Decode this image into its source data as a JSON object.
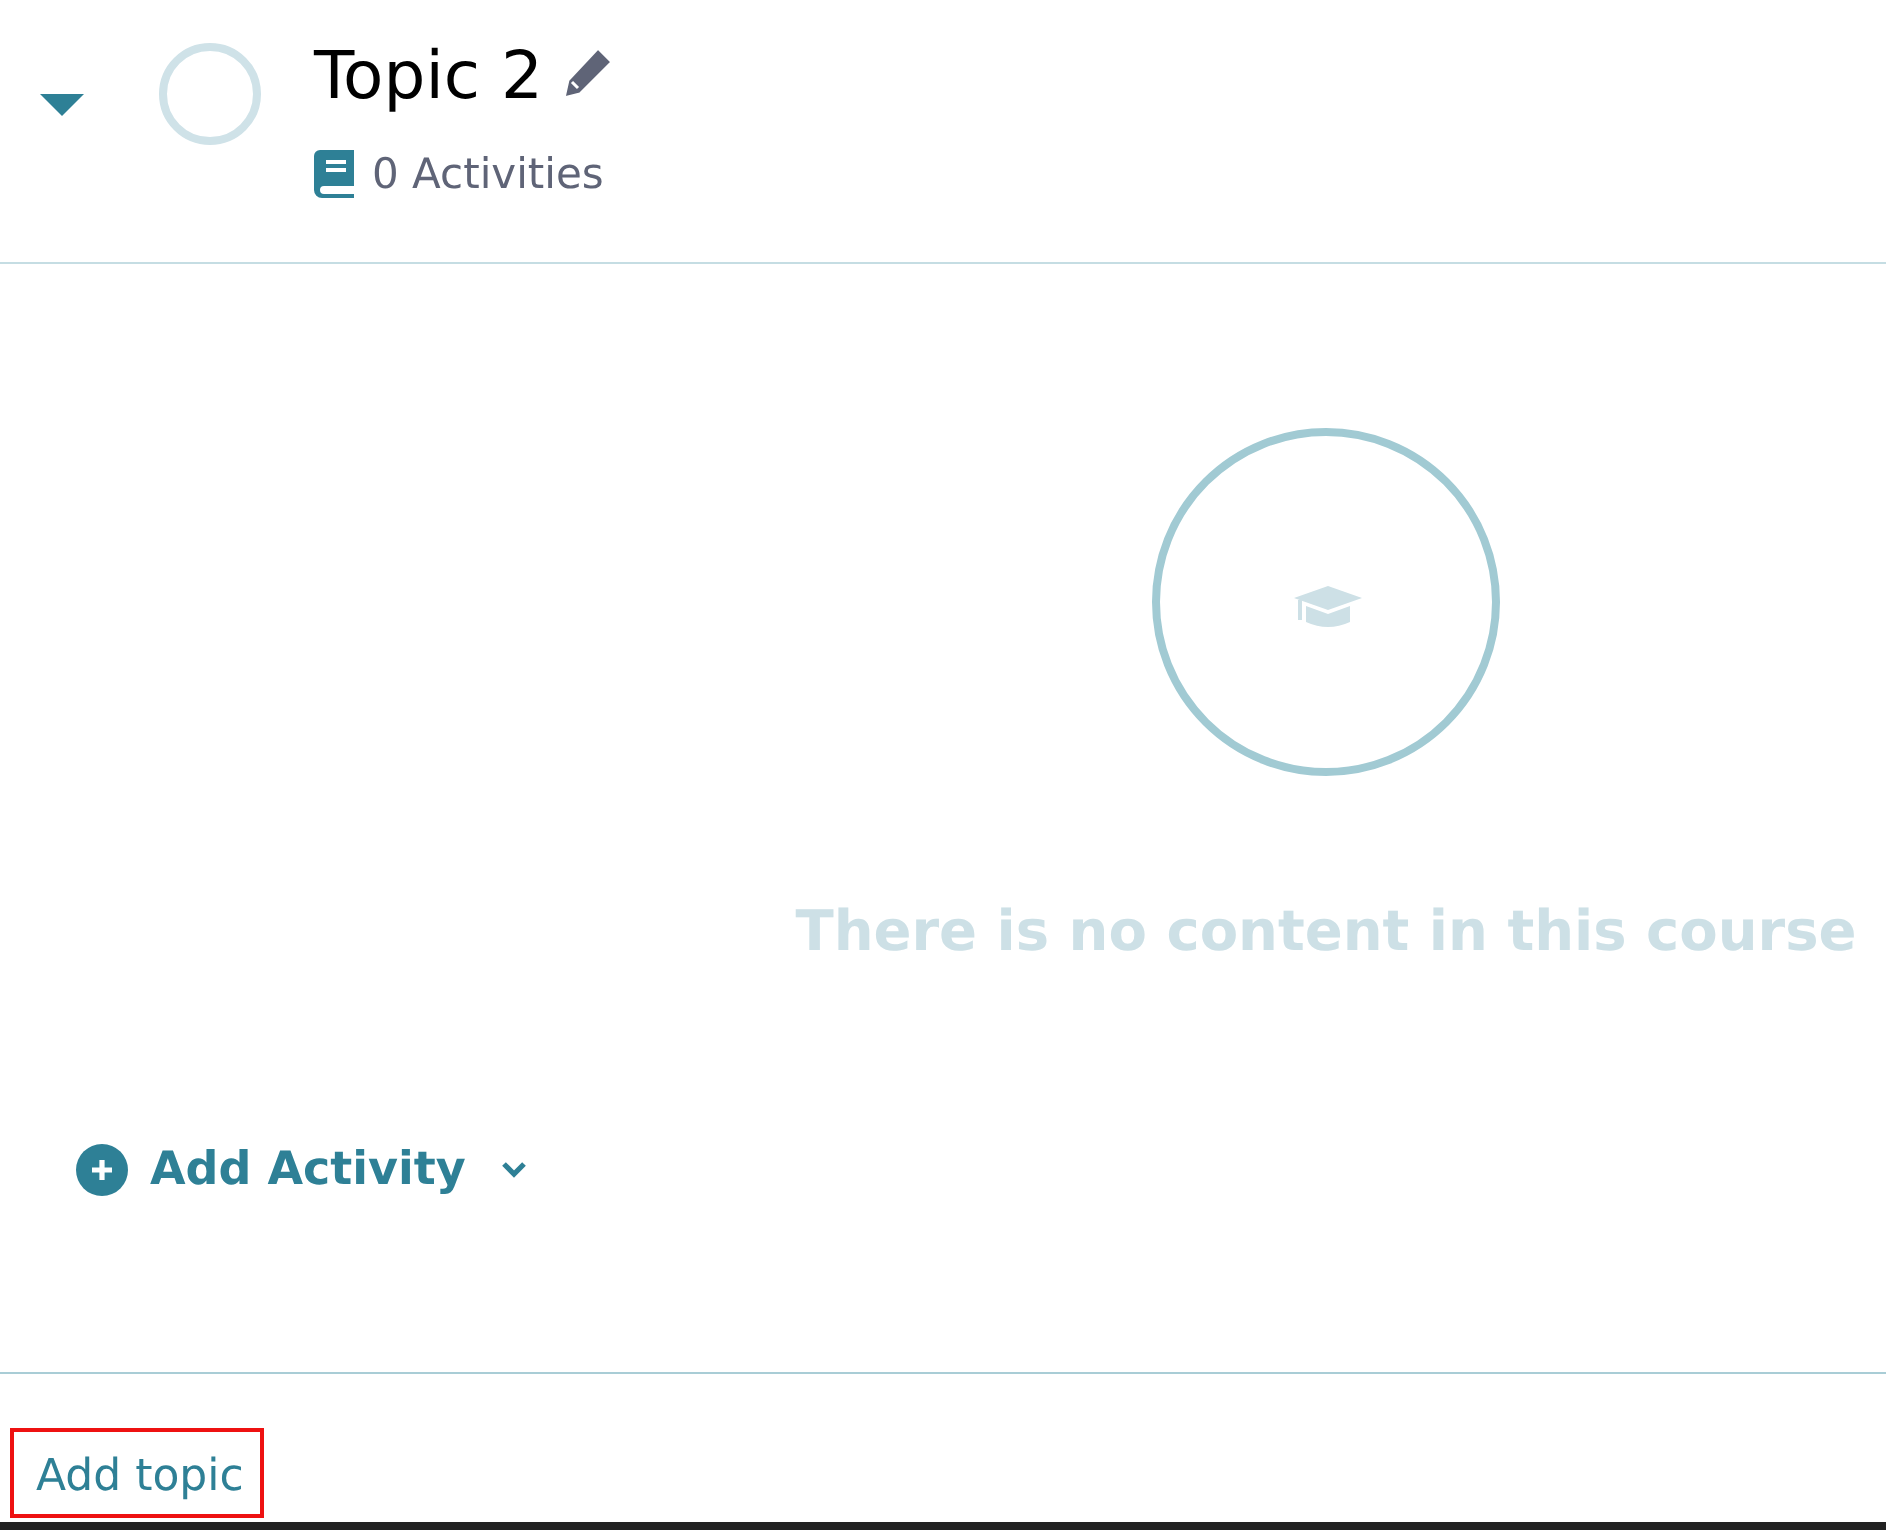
{
  "topic": {
    "title": "Topic 2",
    "expanded": true,
    "activity_count": "0 Activities"
  },
  "empty_state": {
    "message": "There is no content in this course"
  },
  "add_activity": {
    "label": "Add Activity"
  },
  "add_topic": {
    "label": "Add topic",
    "highlighted": true
  }
}
